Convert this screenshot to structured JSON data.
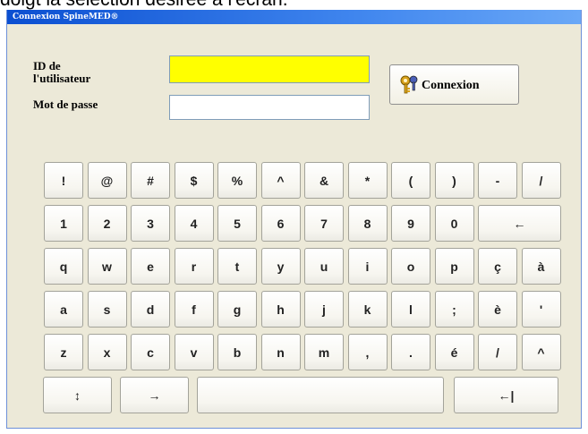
{
  "caption": {
    "text": "doigt la sélection désirée à l'écran."
  },
  "window": {
    "title": "Connexion SpineMED®"
  },
  "form": {
    "user_id_label_line1": "ID de",
    "user_id_label_line2": "l'utilisateur",
    "user_id_value": "",
    "password_label": "Mot de passe",
    "password_value": "",
    "connect_label": "Connexion"
  },
  "colors": {
    "user_id_field": "#ffff00",
    "password_field": "#ffffff",
    "titlebar": "#0b4fd1",
    "window_bg": "#ece9d8"
  },
  "icons": {
    "connect": "key-icon"
  },
  "keyboard": {
    "rows": [
      [
        "!",
        "@",
        "#",
        "$",
        "%",
        "^",
        "&",
        "*",
        "(",
        ")",
        "-",
        "/"
      ],
      [
        "1",
        "2",
        "3",
        "4",
        "5",
        "6",
        "7",
        "8",
        "9",
        "0",
        "←"
      ],
      [
        "q",
        "w",
        "e",
        "r",
        "t",
        "y",
        "u",
        "i",
        "o",
        "p",
        "ç",
        "à"
      ],
      [
        "a",
        "s",
        "d",
        "f",
        "g",
        "h",
        "j",
        "k",
        "l",
        ";",
        "è",
        "'"
      ],
      [
        "z",
        "x",
        "c",
        "v",
        "b",
        "n",
        "m",
        ",",
        ".",
        "é",
        "/",
        "^"
      ],
      [
        "↕",
        "→",
        "",
        "←|"
      ]
    ]
  }
}
